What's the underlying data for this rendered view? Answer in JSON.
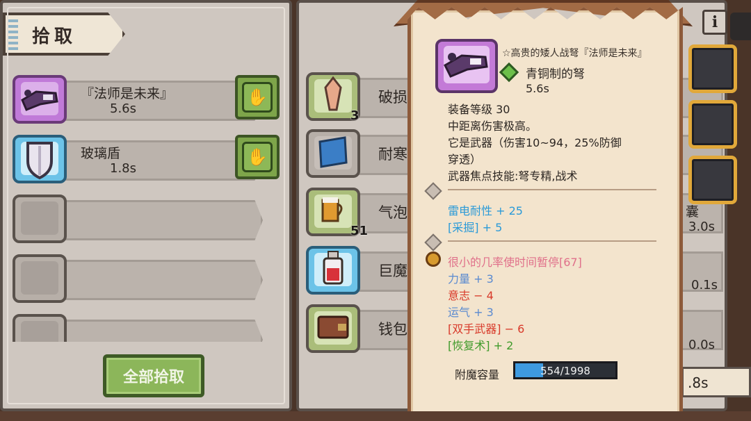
{
  "pickup_panel": {
    "title": "拾取",
    "items": [
      {
        "name": "『法师是未来』",
        "time": "5.6s",
        "rarity": "purple",
        "icon": "crossbow-icon"
      },
      {
        "name": "玻璃盾",
        "time": "1.8s",
        "rarity": "blue",
        "icon": "shield-icon"
      },
      {
        "name": "",
        "time": "",
        "rarity": "empty",
        "icon": ""
      },
      {
        "name": "",
        "time": "",
        "rarity": "empty",
        "icon": ""
      },
      {
        "name": "",
        "time": "",
        "rarity": "empty",
        "icon": ""
      }
    ],
    "take_all_label": "全部拾取"
  },
  "middle_panel": {
    "items": [
      {
        "name": "破损",
        "count": "3",
        "icon": "crystal-icon"
      },
      {
        "name": "耐寒",
        "count": "",
        "icon": "scroll-icon"
      },
      {
        "name": "气泡",
        "count": "51",
        "icon": "beer-mug-icon"
      },
      {
        "name": "巨魔",
        "count": "",
        "icon": "potion-icon"
      },
      {
        "name": "钱包(",
        "count": "",
        "icon": "wallet-icon"
      }
    ],
    "right_times": [
      "3.0s",
      "0.1s",
      "0.0s"
    ],
    "right_peek_name": "囊",
    "bottom_time": ".8s"
  },
  "tooltip": {
    "full_name": "☆高贵的矮人战弩『法师是未来』",
    "sub_name": "青铜制的弩",
    "time": "5.6s",
    "lines": [
      "装备等级 30",
      "中距离伤害极高。",
      "它是武器（伤害10~94，25%防御",
      "穿透）",
      "武器焦点技能:弩专精,战术"
    ],
    "enchant_stats": [
      {
        "text": "雷电耐性 + 25",
        "color": "#2a9ad8"
      },
      {
        "text": "[采掘] + 5",
        "color": "#2a9ad8"
      }
    ],
    "random_stats": [
      {
        "text": "很小的几率使时间暂停[67]",
        "color": "#e0708a"
      },
      {
        "text": "力量 + 3",
        "color": "#5a8ad0"
      },
      {
        "text": "意志 − 4",
        "color": "#d83a2a"
      },
      {
        "text": "运气 + 3",
        "color": "#5a8ad0"
      },
      {
        "text": "[双手武器] − 6",
        "color": "#d83a2a"
      },
      {
        "text": "[恢复术] + 2",
        "color": "#3f9a2a"
      }
    ],
    "enchant_capacity_label": "附魔容量",
    "enchant_capacity_value": "554/1998",
    "enchant_capacity_fraction": 0.277
  },
  "info_button": "i"
}
